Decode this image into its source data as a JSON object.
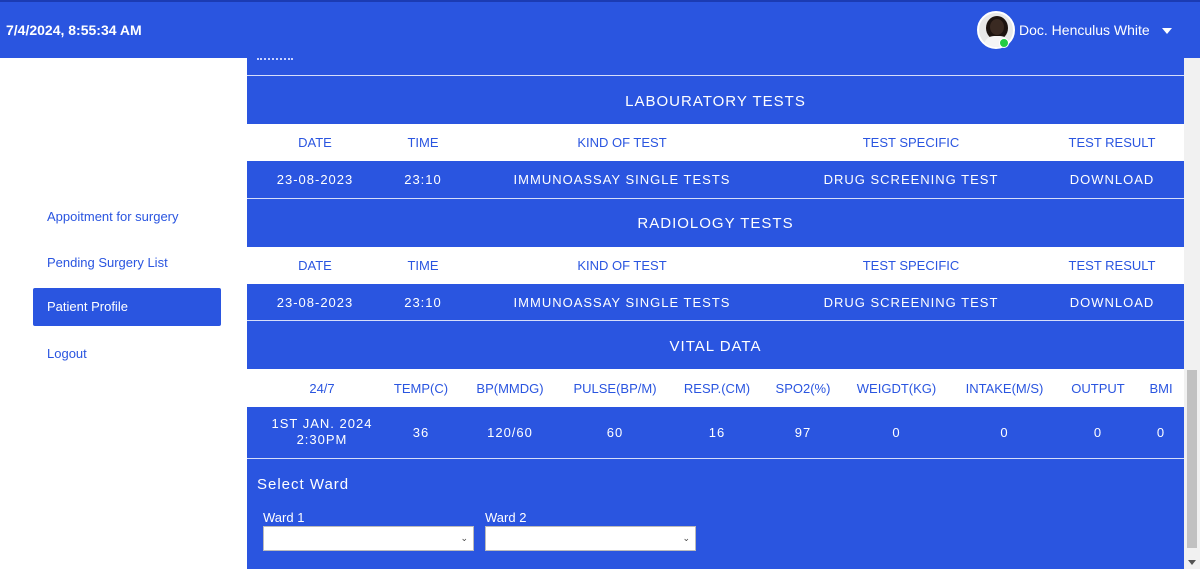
{
  "header": {
    "datetime": "7/4/2024, 8:55:34 AM",
    "user_name": "Doc. Henculus White"
  },
  "sidebar": {
    "items": [
      {
        "label": "Appoitment for surgery",
        "active": false
      },
      {
        "label": "Pending Surgery List",
        "active": false
      },
      {
        "label": "Patient Profile",
        "active": true
      },
      {
        "label": "Logout",
        "active": false
      }
    ]
  },
  "lab": {
    "title": "LABOURATORY TESTS",
    "headers": [
      "DATE",
      "TIME",
      "KIND OF TEST",
      "TEST SPECIFIC",
      "TEST RESULT"
    ],
    "row": [
      "23-08-2023",
      "23:10",
      "IMMUNOASSAY SINGLE TESTS",
      "DRUG SCREENING TEST",
      "DOWNLOAD"
    ]
  },
  "radiology": {
    "title": "RADIOLOGY TESTS",
    "headers": [
      "DATE",
      "TIME",
      "KIND OF TEST",
      "TEST SPECIFIC",
      "TEST RESULT"
    ],
    "row": [
      "23-08-2023",
      "23:10",
      "IMMUNOASSAY SINGLE TESTS",
      "DRUG SCREENING TEST",
      "DOWNLOAD"
    ]
  },
  "vital": {
    "title": "VITAL DATA",
    "headers": [
      "24/7",
      "TEMP(C)",
      "BP(MMDG)",
      "PULSE(BP/M)",
      "RESP.(CM)",
      "SPO2(%)",
      "WEIGDT(KG)",
      "INTAKE(M/S)",
      "OUTPUT",
      "BMI"
    ],
    "row": [
      "1ST JAN. 2024\n2:30PM",
      "36",
      "120/60",
      "60",
      "16",
      "97",
      "0",
      "0",
      "0",
      "0"
    ]
  },
  "ward": {
    "title": "Select Ward",
    "ward1_label": "Ward 1",
    "ward2_label": "Ward 2",
    "ward1_value": "",
    "ward2_value": ""
  },
  "colors": {
    "accent": "#2a55e0",
    "online": "#22cc44"
  }
}
